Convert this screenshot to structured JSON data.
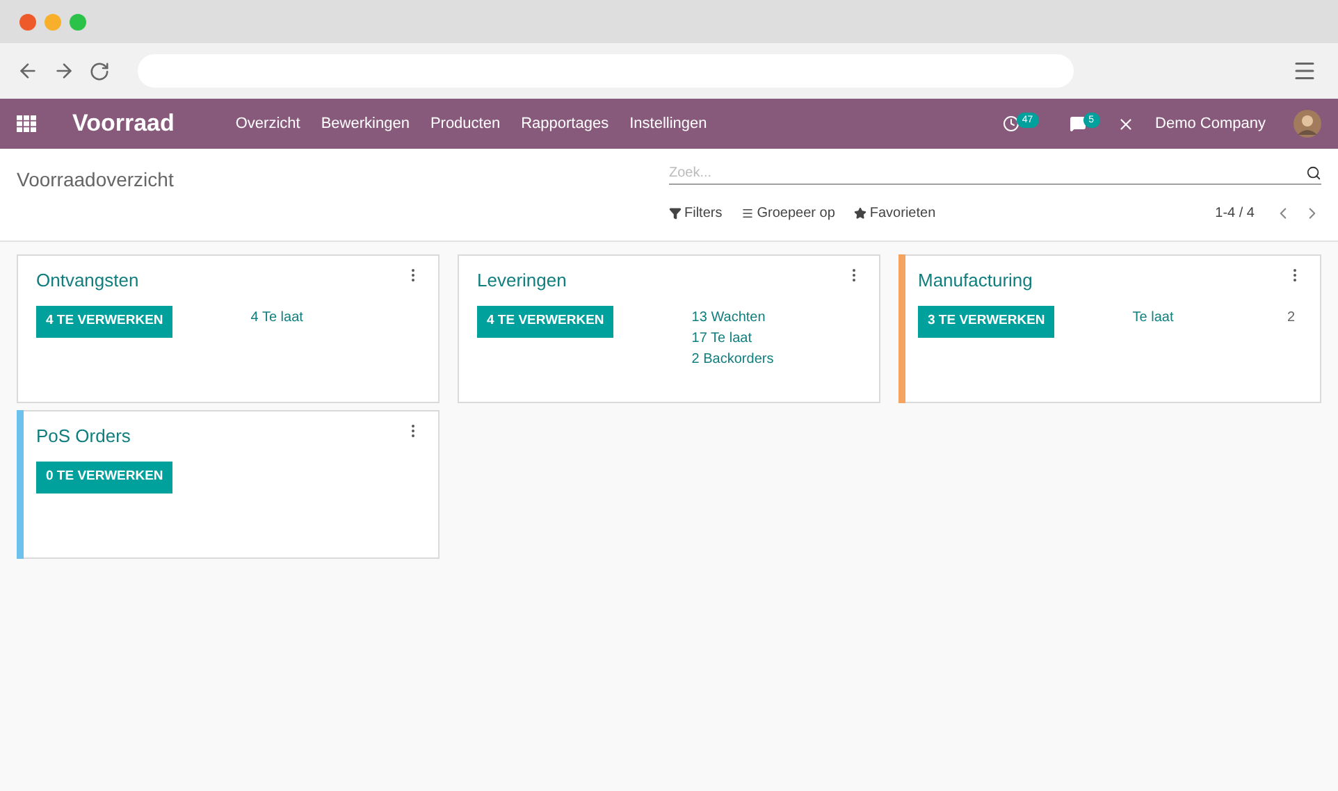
{
  "navbar": {
    "app_title": "Voorraad",
    "menu": [
      "Overzicht",
      "Bewerkingen",
      "Producten",
      "Rapportages",
      "Instellingen"
    ],
    "activity_count": "47",
    "message_count": "5",
    "company": "Demo Company"
  },
  "control_panel": {
    "breadcrumb": "Voorraadoverzicht",
    "search": {
      "placeholder": "Zoek..."
    },
    "filters": [
      "Filters",
      "Groepeer op",
      "Favorieten"
    ],
    "pager": "1-4 / 4"
  },
  "cards": [
    {
      "title": "Ontvangsten",
      "button": "4 TE VERWERKEN",
      "links": [
        {
          "label": "4 Te laat"
        }
      ]
    },
    {
      "title": "Leveringen",
      "button": "4 TE VERWERKEN",
      "links": [
        {
          "label": "13 Wachten"
        },
        {
          "label": "17 Te laat"
        },
        {
          "label": "2 Backorders"
        }
      ]
    },
    {
      "title": "Manufacturing",
      "button": "3 TE VERWERKEN",
      "color": "#f4a460",
      "links": [
        {
          "label": "Te laat",
          "value": "2"
        }
      ]
    },
    {
      "title": "PoS Orders",
      "button": "0 TE VERWERKEN",
      "color": "#6cc1ed"
    }
  ]
}
